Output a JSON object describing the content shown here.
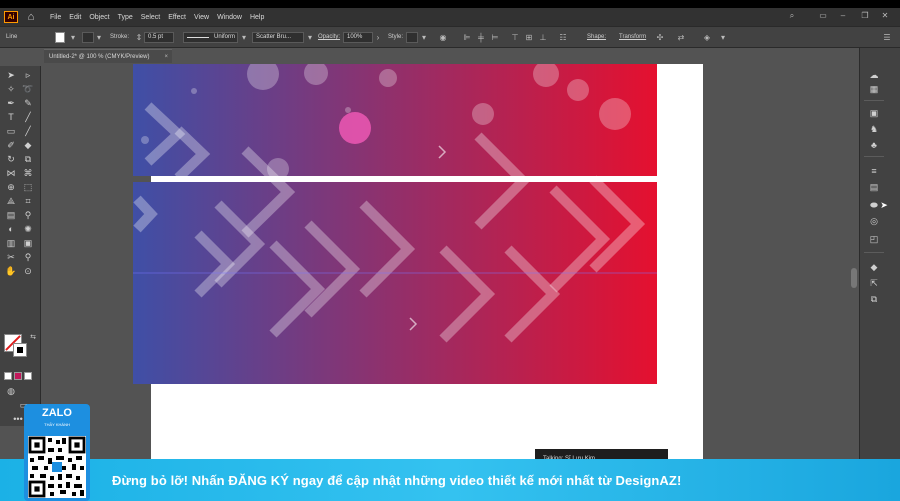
{
  "app": {
    "logo": "Ai",
    "menu": [
      "File",
      "Edit",
      "Object",
      "Type",
      "Select",
      "Effect",
      "View",
      "Window",
      "Help"
    ]
  },
  "control_bar": {
    "selection": "Line",
    "stroke_label": "Stroke:",
    "stroke_value": "0.5 pt",
    "profile": "Uniform",
    "brush": "Scatter Bru...",
    "opacity_label": "Opacity:",
    "opacity_value": "100%",
    "style_label": "Style:",
    "shape_label": "Shape:",
    "transform_label": "Transform"
  },
  "document": {
    "tab_title": "Untitled-2* @ 100 % (CMYK/Preview)",
    "close": "×"
  },
  "artwork": {
    "gradient_start": "#3f4fa6",
    "gradient_end": "#e5102f",
    "guide_color": "#7a74ff"
  },
  "tooltip": {
    "text": "Talking: Sĩ Lưu Kim"
  },
  "banner": {
    "text": "Đừng bỏ lỡ! Nhấn ĐĂNG KÝ ngay để cập nhật những video thiết kế mới nhất từ DesignAZ!",
    "color": "#1bb1e6"
  },
  "zalo": {
    "title": "ZALO",
    "subtitle": "THẦY KHÁNH"
  }
}
